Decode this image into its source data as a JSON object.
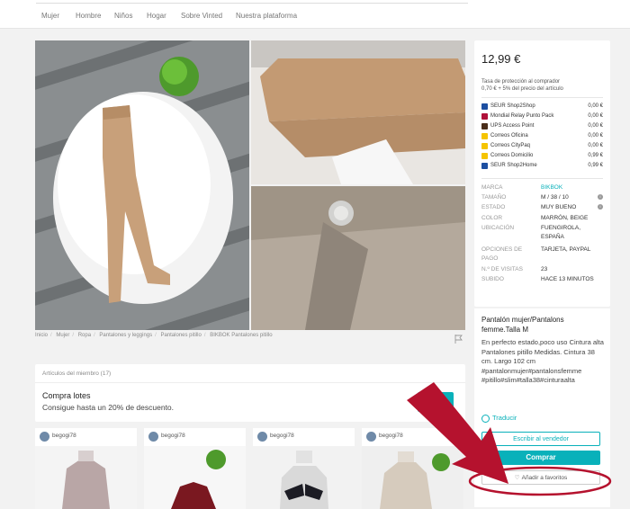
{
  "nav": {
    "items": [
      "Mujer",
      "Hombre",
      "Niños",
      "Hogar",
      "Sobre Vinted",
      "Nuestra plataforma"
    ]
  },
  "breadcrumb": [
    "Inicio",
    "Mujer",
    "Ropa",
    "Pantalones y leggings",
    "Pantalones pitillo",
    "BIKBOK Pantalones pitillo"
  ],
  "member_items": {
    "header": "Artículos del miembro (17)",
    "bundle_title": "Compra lotes",
    "bundle_desc": "Consigue hasta un 20% de descuento."
  },
  "cards": [
    {
      "user": "begogi78"
    },
    {
      "user": "begogi78"
    },
    {
      "user": "begogi78"
    },
    {
      "user": "begogi78"
    }
  ],
  "sidebar": {
    "price": "12,99 €",
    "protection_line1": "Tasa de protección al comprador",
    "protection_line2": "0,70 € + 5% del precio del artículo",
    "shipping": [
      {
        "name": "SEUR Shop2Shop",
        "cost": "0,00 €",
        "color": "#1d4fa1"
      },
      {
        "name": "Mondial Relay Punto Pack",
        "cost": "0,00 €",
        "color": "#b0123a"
      },
      {
        "name": "UPS Access Point",
        "cost": "0,00 €",
        "color": "#4a2e1a"
      },
      {
        "name": "Correos Oficina",
        "cost": "0,00 €",
        "color": "#f5c400"
      },
      {
        "name": "Correos CityPaq",
        "cost": "0,00 €",
        "color": "#f5c400"
      },
      {
        "name": "Correos Domicilio",
        "cost": "0,99 €",
        "color": "#f5c400"
      },
      {
        "name": "SEUR Shop2Home",
        "cost": "0,99 €",
        "color": "#1d4fa1"
      }
    ],
    "details": [
      {
        "label": "MARCA",
        "value": "BIKBOK"
      },
      {
        "label": "TAMAÑO",
        "value": "M / 38 / 10"
      },
      {
        "label": "ESTADO",
        "value": "MUY BUENO"
      },
      {
        "label": "COLOR",
        "value": "MARRÓN, BEIGE"
      },
      {
        "label": "UBICACIÓN",
        "value": "FUENGIROLA, ESPAÑA"
      },
      {
        "label": "OPCIONES DE PAGO",
        "value": "TARJETA, PAYPAL"
      },
      {
        "label": "N.º DE VISITAS",
        "value": "23"
      },
      {
        "label": "SUBIDO",
        "value": "HACE 13 MINUTOS"
      }
    ]
  },
  "description": {
    "title": "Pantalón mujer/Pantalons femme.Talla M",
    "body": "En perfecto estado,poco uso Cintura alta Pantalones pitillo Medidas. Cintura 38 cm. Largo 102 cm #pantalonmujer#pantalonsfemme #pitillo#slim#talla38#cinturaalta",
    "translate": "Traducir",
    "message_btn": "Escribir al vendedor",
    "buy_btn": "Comprar",
    "fav_btn": "Añadir a favoritos"
  },
  "colors": {
    "accent": "#09b1ba",
    "annotation_red": "#b5122e"
  }
}
